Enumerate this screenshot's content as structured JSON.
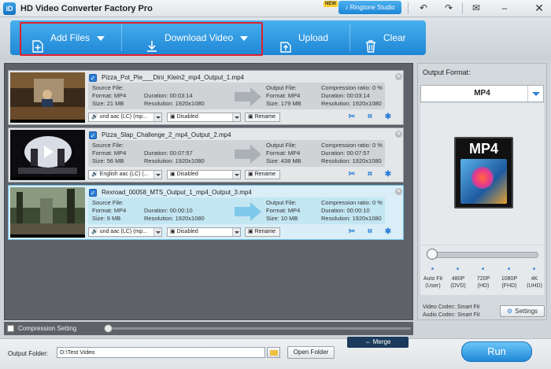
{
  "app": {
    "logo": "iD",
    "title": "HD Video Converter Factory Pro",
    "new_badge": "NEW",
    "ringtone_studio": "Ringtone Studio"
  },
  "titlebar_icons": [
    "undo-icon",
    "redo-icon",
    "message-icon",
    "minimize-icon",
    "close-icon"
  ],
  "toolbar": {
    "add_files": "Add Files",
    "download_video": "Download Video",
    "upload": "Upload",
    "clear": "Clear",
    "accent": "#1f86d6",
    "highlight_color": "#e0202a"
  },
  "tasks": [
    {
      "file": "Pizza_Pot_Pie___Dini_Klein2_mp4_Output_1.mp4",
      "source_label": "Source File:",
      "source_format": "Format: MP4",
      "source_duration": "Duration: 00:03:14",
      "source_size": "Size: 21 MB",
      "source_resolution": "Resolution: 1920x1080",
      "output_label": "Output File:",
      "output_format": "Format: MP4",
      "output_duration": "Duration: 00:03:14",
      "output_size": "Size: 179 MB",
      "output_resolution": "Resolution: 1920x1080",
      "compression": "Compression ratio: 0 %",
      "audio": "und aac (LC) (mp...",
      "subtitle": "Disabled",
      "rename": "Rename"
    },
    {
      "file": "Pizza_Slap_Challenge_2_mp4_Output_2.mp4",
      "source_label": "Source File:",
      "source_format": "Format: MP4",
      "source_duration": "Duration: 00:07:57",
      "source_size": "Size: 56 MB",
      "source_resolution": "Resolution: 1920x1080",
      "output_label": "Output File:",
      "output_format": "Format: MP4",
      "output_duration": "Duration: 00:07:57",
      "output_size": "Size: 438 MB",
      "output_resolution": "Resolution: 1920x1080",
      "compression": "Compression ratio: 0 %",
      "audio": "English aac (LC) (...",
      "subtitle": "Disabled",
      "rename": "Rename"
    },
    {
      "file": "Rexroad_00058_MTS_Output_1_mp4_Output_3.mp4",
      "source_label": "Source File:",
      "source_format": "Format: MP4",
      "source_duration": "Duration: 00:00:10",
      "source_size": "Size: 9 MB",
      "source_resolution": "Resolution: 1920x1080",
      "output_label": "Output File:",
      "output_format": "Format: MP4",
      "output_duration": "Duration: 00:00:10",
      "output_size": "Size: 10 MB",
      "output_resolution": "Resolution: 1920x1080",
      "compression": "Compression ratio: 0 %",
      "audio": "und aac (LC) (mp...",
      "subtitle": "Disabled",
      "rename": "Rename"
    }
  ],
  "compression_setting": "Compression Setting",
  "merge": "Merge",
  "output_folder": {
    "label": "Output Folder:",
    "value": "D:\\Test Video",
    "open_folder": "Open Folder"
  },
  "run": "Run",
  "right_panel": {
    "title": "Output Format:",
    "format": "MP4",
    "icon_text": "MP4",
    "resolutions": [
      {
        "line1": "Auto Fit",
        "line2": "(User)"
      },
      {
        "line1": "480P",
        "line2": "(DVD)"
      },
      {
        "line1": "720P",
        "line2": "(HD)"
      },
      {
        "line1": "1080P",
        "line2": "(FHD)"
      },
      {
        "line1": "4K",
        "line2": "(UHD)"
      }
    ],
    "video_codec": "Video Codec: Smart Fit",
    "audio_codec": "Audio Codec: Smart Fit",
    "settings": "Settings"
  }
}
